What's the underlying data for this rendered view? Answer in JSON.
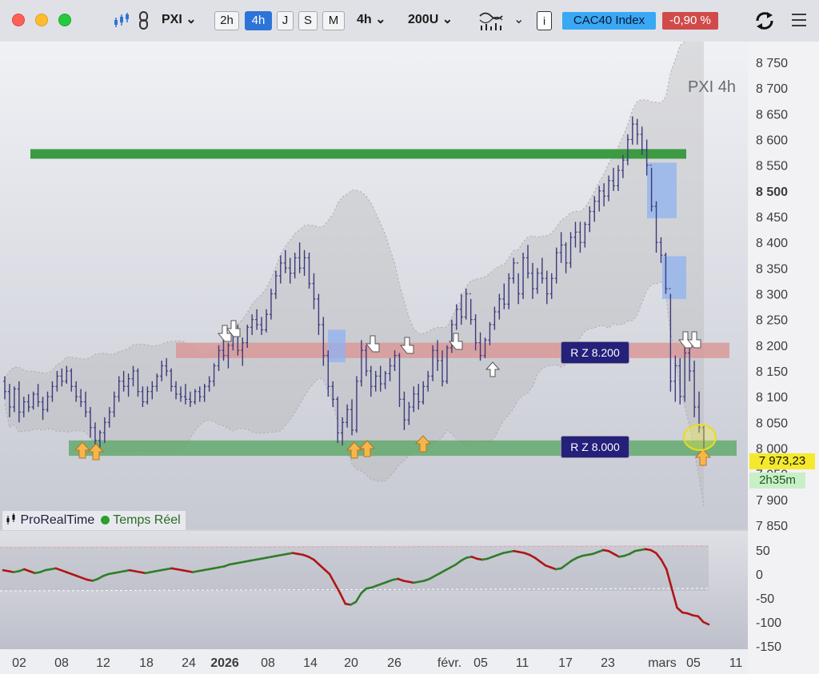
{
  "toolbar": {
    "symbol": "PXI",
    "timeframes": [
      "2h",
      "4h",
      "J",
      "S",
      "M"
    ],
    "active_timeframe": "4h",
    "interval": "4h",
    "bars": "200U",
    "info": "i",
    "index_name": "CAC40 Index",
    "change": "-0,90 %"
  },
  "chart_title": "PXI  4h",
  "price_axis": [
    "8 750",
    "8 700",
    "8 650",
    "8 600",
    "8 550",
    "8 500",
    "8 450",
    "8 400",
    "8 350",
    "8 300",
    "8 250",
    "8 200",
    "8 150",
    "8 100",
    "8 050",
    "8 000",
    "7 950",
    "7 900",
    "7 850"
  ],
  "indicator_axis": [
    "50",
    "0",
    "-50",
    "-100",
    "-150"
  ],
  "date_axis": [
    "02",
    "08",
    "12",
    "18",
    "24",
    "2026",
    "08",
    "14",
    "20",
    "26",
    "févr.",
    "05",
    "11",
    "17",
    "23",
    "mars",
    "05",
    "11"
  ],
  "last_price": "7 973,23",
  "time_left": "2h35m",
  "brand": {
    "name": "ProRealTime",
    "status": "Temps Réel"
  },
  "zones": [
    {
      "label": "R Z 8.200",
      "value": 8190
    },
    {
      "label": "R Z 8.000",
      "value": 8000
    }
  ],
  "colors": {
    "candle": "#3b3a7a",
    "resistance_zone": "#d99a9a",
    "support_zone": "#5ea868",
    "top_line": "#3c9a42",
    "highlight": "#8fb2f0",
    "up_arrow": "#f8b64a",
    "oscillator_up": "#2f7d2a",
    "oscillator_down": "#b01616"
  },
  "chart_data": {
    "type": "candlestick",
    "title": "PXI  4h",
    "ylim": [
      7850,
      8780
    ],
    "oscillator_ylim": [
      -150,
      60
    ],
    "candles": [
      {
        "o": 8130,
        "h": 8140,
        "l": 8095,
        "c": 8110
      },
      {
        "o": 8110,
        "h": 8125,
        "l": 8060,
        "c": 8080
      },
      {
        "o": 8080,
        "h": 8120,
        "l": 8070,
        "c": 8115
      },
      {
        "o": 8115,
        "h": 8130,
        "l": 8050,
        "c": 8070
      },
      {
        "o": 8070,
        "h": 8100,
        "l": 8060,
        "c": 8090
      },
      {
        "o": 8090,
        "h": 8105,
        "l": 8070,
        "c": 8080
      },
      {
        "o": 8080,
        "h": 8110,
        "l": 8075,
        "c": 8105
      },
      {
        "o": 8105,
        "h": 8125,
        "l": 8080,
        "c": 8090
      },
      {
        "o": 8090,
        "h": 8100,
        "l": 8055,
        "c": 8075
      },
      {
        "o": 8075,
        "h": 8110,
        "l": 8070,
        "c": 8100
      },
      {
        "o": 8100,
        "h": 8130,
        "l": 8090,
        "c": 8120
      },
      {
        "o": 8120,
        "h": 8150,
        "l": 8110,
        "c": 8140
      },
      {
        "o": 8140,
        "h": 8155,
        "l": 8120,
        "c": 8130
      },
      {
        "o": 8130,
        "h": 8160,
        "l": 8125,
        "c": 8150
      },
      {
        "o": 8150,
        "h": 8155,
        "l": 8110,
        "c": 8120
      },
      {
        "o": 8120,
        "h": 8130,
        "l": 8090,
        "c": 8100
      },
      {
        "o": 8100,
        "h": 8115,
        "l": 8080,
        "c": 8090
      },
      {
        "o": 8090,
        "h": 8110,
        "l": 8060,
        "c": 8070
      },
      {
        "o": 8070,
        "h": 8080,
        "l": 8020,
        "c": 8040
      },
      {
        "o": 8040,
        "h": 8050,
        "l": 8005,
        "c": 8015
      },
      {
        "o": 8015,
        "h": 8035,
        "l": 8000,
        "c": 8030
      },
      {
        "o": 8030,
        "h": 8060,
        "l": 8010,
        "c": 8050
      },
      {
        "o": 8050,
        "h": 8080,
        "l": 8040,
        "c": 8070
      },
      {
        "o": 8070,
        "h": 8110,
        "l": 8060,
        "c": 8100
      },
      {
        "o": 8100,
        "h": 8140,
        "l": 8090,
        "c": 8130
      },
      {
        "o": 8130,
        "h": 8150,
        "l": 8110,
        "c": 8120
      },
      {
        "o": 8120,
        "h": 8145,
        "l": 8100,
        "c": 8135
      },
      {
        "o": 8135,
        "h": 8160,
        "l": 8120,
        "c": 8150
      },
      {
        "o": 8150,
        "h": 8155,
        "l": 8100,
        "c": 8110
      },
      {
        "o": 8110,
        "h": 8120,
        "l": 8080,
        "c": 8090
      },
      {
        "o": 8090,
        "h": 8120,
        "l": 8085,
        "c": 8110
      },
      {
        "o": 8110,
        "h": 8130,
        "l": 8095,
        "c": 8120
      },
      {
        "o": 8120,
        "h": 8145,
        "l": 8110,
        "c": 8140
      },
      {
        "o": 8140,
        "h": 8170,
        "l": 8130,
        "c": 8160
      },
      {
        "o": 8160,
        "h": 8175,
        "l": 8140,
        "c": 8150
      },
      {
        "o": 8150,
        "h": 8155,
        "l": 8110,
        "c": 8120
      },
      {
        "o": 8120,
        "h": 8130,
        "l": 8095,
        "c": 8105
      },
      {
        "o": 8105,
        "h": 8120,
        "l": 8090,
        "c": 8100
      },
      {
        "o": 8100,
        "h": 8125,
        "l": 8085,
        "c": 8095
      },
      {
        "o": 8095,
        "h": 8110,
        "l": 8080,
        "c": 8090
      },
      {
        "o": 8090,
        "h": 8115,
        "l": 8085,
        "c": 8110
      },
      {
        "o": 8110,
        "h": 8120,
        "l": 8090,
        "c": 8100
      },
      {
        "o": 8100,
        "h": 8125,
        "l": 8090,
        "c": 8120
      },
      {
        "o": 8120,
        "h": 8140,
        "l": 8110,
        "c": 8130
      },
      {
        "o": 8130,
        "h": 8165,
        "l": 8120,
        "c": 8160
      },
      {
        "o": 8160,
        "h": 8200,
        "l": 8150,
        "c": 8190
      },
      {
        "o": 8190,
        "h": 8215,
        "l": 8170,
        "c": 8180
      },
      {
        "o": 8180,
        "h": 8205,
        "l": 8155,
        "c": 8200
      },
      {
        "o": 8200,
        "h": 8230,
        "l": 8190,
        "c": 8220
      },
      {
        "o": 8220,
        "h": 8240,
        "l": 8180,
        "c": 8190
      },
      {
        "o": 8190,
        "h": 8215,
        "l": 8160,
        "c": 8205
      },
      {
        "o": 8205,
        "h": 8240,
        "l": 8195,
        "c": 8235
      },
      {
        "o": 8235,
        "h": 8260,
        "l": 8220,
        "c": 8250
      },
      {
        "o": 8250,
        "h": 8270,
        "l": 8230,
        "c": 8240
      },
      {
        "o": 8240,
        "h": 8255,
        "l": 8220,
        "c": 8230
      },
      {
        "o": 8230,
        "h": 8270,
        "l": 8225,
        "c": 8260
      },
      {
        "o": 8260,
        "h": 8310,
        "l": 8250,
        "c": 8300
      },
      {
        "o": 8300,
        "h": 8345,
        "l": 8290,
        "c": 8335
      },
      {
        "o": 8335,
        "h": 8375,
        "l": 8320,
        "c": 8360
      },
      {
        "o": 8360,
        "h": 8385,
        "l": 8340,
        "c": 8350
      },
      {
        "o": 8350,
        "h": 8370,
        "l": 8320,
        "c": 8340
      },
      {
        "o": 8340,
        "h": 8380,
        "l": 8330,
        "c": 8370
      },
      {
        "o": 8370,
        "h": 8400,
        "l": 8340,
        "c": 8350
      },
      {
        "o": 8350,
        "h": 8385,
        "l": 8335,
        "c": 8370
      },
      {
        "o": 8370,
        "h": 8380,
        "l": 8310,
        "c": 8320
      },
      {
        "o": 8320,
        "h": 8340,
        "l": 8270,
        "c": 8290
      },
      {
        "o": 8290,
        "h": 8300,
        "l": 8220,
        "c": 8240
      },
      {
        "o": 8240,
        "h": 8255,
        "l": 8160,
        "c": 8180
      },
      {
        "o": 8180,
        "h": 8190,
        "l": 8100,
        "c": 8120
      },
      {
        "o": 8120,
        "h": 8130,
        "l": 8080,
        "c": 8095
      },
      {
        "o": 8095,
        "h": 8100,
        "l": 8010,
        "c": 8030
      },
      {
        "o": 8030,
        "h": 8060,
        "l": 8005,
        "c": 8050
      },
      {
        "o": 8050,
        "h": 8085,
        "l": 8040,
        "c": 8075
      },
      {
        "o": 8075,
        "h": 8095,
        "l": 8025,
        "c": 8035
      },
      {
        "o": 8035,
        "h": 8140,
        "l": 8030,
        "c": 8130
      },
      {
        "o": 8130,
        "h": 8210,
        "l": 8120,
        "c": 8190
      },
      {
        "o": 8190,
        "h": 8200,
        "l": 8140,
        "c": 8150
      },
      {
        "o": 8150,
        "h": 8160,
        "l": 8100,
        "c": 8120
      },
      {
        "o": 8120,
        "h": 8150,
        "l": 8110,
        "c": 8140
      },
      {
        "o": 8140,
        "h": 8160,
        "l": 8110,
        "c": 8125
      },
      {
        "o": 8125,
        "h": 8150,
        "l": 8115,
        "c": 8145
      },
      {
        "o": 8145,
        "h": 8175,
        "l": 8130,
        "c": 8160
      },
      {
        "o": 8160,
        "h": 8190,
        "l": 8150,
        "c": 8180
      },
      {
        "o": 8180,
        "h": 8185,
        "l": 8080,
        "c": 8095
      },
      {
        "o": 8095,
        "h": 8110,
        "l": 8035,
        "c": 8055
      },
      {
        "o": 8055,
        "h": 8090,
        "l": 8045,
        "c": 8080
      },
      {
        "o": 8080,
        "h": 8120,
        "l": 8070,
        "c": 8105
      },
      {
        "o": 8105,
        "h": 8125,
        "l": 8075,
        "c": 8090
      },
      {
        "o": 8090,
        "h": 8130,
        "l": 8085,
        "c": 8120
      },
      {
        "o": 8120,
        "h": 8150,
        "l": 8110,
        "c": 8140
      },
      {
        "o": 8140,
        "h": 8200,
        "l": 8130,
        "c": 8190
      },
      {
        "o": 8190,
        "h": 8210,
        "l": 8150,
        "c": 8170
      },
      {
        "o": 8170,
        "h": 8190,
        "l": 8120,
        "c": 8130
      },
      {
        "o": 8130,
        "h": 8200,
        "l": 8125,
        "c": 8195
      },
      {
        "o": 8195,
        "h": 8250,
        "l": 8185,
        "c": 8240
      },
      {
        "o": 8240,
        "h": 8280,
        "l": 8230,
        "c": 8270
      },
      {
        "o": 8270,
        "h": 8300,
        "l": 8240,
        "c": 8255
      },
      {
        "o": 8255,
        "h": 8310,
        "l": 8250,
        "c": 8300
      },
      {
        "o": 8300,
        "h": 8290,
        "l": 8240,
        "c": 8250
      },
      {
        "o": 8250,
        "h": 8260,
        "l": 8190,
        "c": 8205
      },
      {
        "o": 8205,
        "h": 8225,
        "l": 8170,
        "c": 8180
      },
      {
        "o": 8180,
        "h": 8215,
        "l": 8175,
        "c": 8210
      },
      {
        "o": 8210,
        "h": 8245,
        "l": 8200,
        "c": 8240
      },
      {
        "o": 8240,
        "h": 8275,
        "l": 8230,
        "c": 8265
      },
      {
        "o": 8265,
        "h": 8300,
        "l": 8250,
        "c": 8290
      },
      {
        "o": 8290,
        "h": 8320,
        "l": 8270,
        "c": 8280
      },
      {
        "o": 8280,
        "h": 8340,
        "l": 8270,
        "c": 8330
      },
      {
        "o": 8330,
        "h": 8370,
        "l": 8320,
        "c": 8360
      },
      {
        "o": 8360,
        "h": 8340,
        "l": 8280,
        "c": 8300
      },
      {
        "o": 8300,
        "h": 8380,
        "l": 8290,
        "c": 8370
      },
      {
        "o": 8370,
        "h": 8395,
        "l": 8330,
        "c": 8340
      },
      {
        "o": 8340,
        "h": 8360,
        "l": 8290,
        "c": 8310
      },
      {
        "o": 8310,
        "h": 8350,
        "l": 8300,
        "c": 8340
      },
      {
        "o": 8340,
        "h": 8370,
        "l": 8320,
        "c": 8330
      },
      {
        "o": 8330,
        "h": 8345,
        "l": 8280,
        "c": 8300
      },
      {
        "o": 8300,
        "h": 8340,
        "l": 8290,
        "c": 8330
      },
      {
        "o": 8330,
        "h": 8390,
        "l": 8320,
        "c": 8380
      },
      {
        "o": 8380,
        "h": 8420,
        "l": 8360,
        "c": 8395
      },
      {
        "o": 8395,
        "h": 8400,
        "l": 8340,
        "c": 8360
      },
      {
        "o": 8360,
        "h": 8420,
        "l": 8350,
        "c": 8410
      },
      {
        "o": 8410,
        "h": 8440,
        "l": 8390,
        "c": 8420
      },
      {
        "o": 8420,
        "h": 8440,
        "l": 8380,
        "c": 8400
      },
      {
        "o": 8400,
        "h": 8440,
        "l": 8390,
        "c": 8435
      },
      {
        "o": 8435,
        "h": 8470,
        "l": 8420,
        "c": 8460
      },
      {
        "o": 8460,
        "h": 8490,
        "l": 8440,
        "c": 8480
      },
      {
        "o": 8480,
        "h": 8510,
        "l": 8460,
        "c": 8500
      },
      {
        "o": 8500,
        "h": 8515,
        "l": 8470,
        "c": 8490
      },
      {
        "o": 8490,
        "h": 8530,
        "l": 8480,
        "c": 8520
      },
      {
        "o": 8520,
        "h": 8545,
        "l": 8500,
        "c": 8510
      },
      {
        "o": 8510,
        "h": 8550,
        "l": 8500,
        "c": 8540
      },
      {
        "o": 8540,
        "h": 8570,
        "l": 8525,
        "c": 8560
      },
      {
        "o": 8560,
        "h": 8610,
        "l": 8550,
        "c": 8600
      },
      {
        "o": 8600,
        "h": 8645,
        "l": 8590,
        "c": 8630
      },
      {
        "o": 8630,
        "h": 8640,
        "l": 8590,
        "c": 8610
      },
      {
        "o": 8610,
        "h": 8625,
        "l": 8570,
        "c": 8580
      },
      {
        "o": 8580,
        "h": 8600,
        "l": 8530,
        "c": 8550
      },
      {
        "o": 8550,
        "h": 8545,
        "l": 8460,
        "c": 8470
      },
      {
        "o": 8470,
        "h": 8480,
        "l": 8380,
        "c": 8400
      },
      {
        "o": 8400,
        "h": 8410,
        "l": 8360,
        "c": 8375
      },
      {
        "o": 8375,
        "h": 8380,
        "l": 8300,
        "c": 8310
      },
      {
        "o": 8310,
        "h": 8300,
        "l": 8110,
        "c": 8130
      },
      {
        "o": 8130,
        "h": 8180,
        "l": 8090,
        "c": 8160
      },
      {
        "o": 8160,
        "h": 8175,
        "l": 8085,
        "c": 8100
      },
      {
        "o": 8100,
        "h": 8200,
        "l": 8090,
        "c": 8185
      },
      {
        "o": 8185,
        "h": 8205,
        "l": 8130,
        "c": 8150
      },
      {
        "o": 8150,
        "h": 8170,
        "l": 8060,
        "c": 8080
      },
      {
        "o": 8080,
        "h": 8110,
        "l": 8030,
        "c": 8040
      },
      {
        "o": 8040,
        "h": 8045,
        "l": 7995,
        "c": 7973
      }
    ],
    "zones": [
      {
        "name": "R Z 8.200",
        "low": 8175,
        "high": 8205
      },
      {
        "name": "R Z 8.000",
        "low": 7985,
        "high": 8015
      }
    ],
    "top_line": 8572,
    "oscillator": [
      8,
      6,
      4,
      6,
      10,
      6,
      2,
      4,
      8,
      10,
      12,
      8,
      4,
      0,
      -4,
      -8,
      -12,
      -14,
      -10,
      -4,
      0,
      2,
      4,
      6,
      8,
      6,
      4,
      2,
      4,
      6,
      8,
      10,
      12,
      10,
      8,
      6,
      4,
      6,
      8,
      10,
      12,
      14,
      16,
      20,
      22,
      24,
      26,
      28,
      30,
      32,
      34,
      36,
      38,
      40,
      42,
      44,
      42,
      40,
      36,
      30,
      20,
      10,
      0,
      -20,
      -40,
      -62,
      -64,
      -58,
      -40,
      -30,
      -28,
      -24,
      -20,
      -16,
      -12,
      -10,
      -14,
      -16,
      -18,
      -16,
      -14,
      -10,
      -4,
      2,
      8,
      14,
      20,
      28,
      34,
      36,
      32,
      30,
      32,
      36,
      40,
      44,
      46,
      48,
      46,
      44,
      40,
      34,
      26,
      18,
      14,
      10,
      12,
      20,
      28,
      34,
      38,
      40,
      42,
      46,
      50,
      48,
      42,
      36,
      38,
      42,
      48,
      50,
      52,
      50,
      44,
      30,
      10,
      -30,
      -70,
      -80,
      -82,
      -86,
      -88,
      -100,
      -105
    ]
  }
}
